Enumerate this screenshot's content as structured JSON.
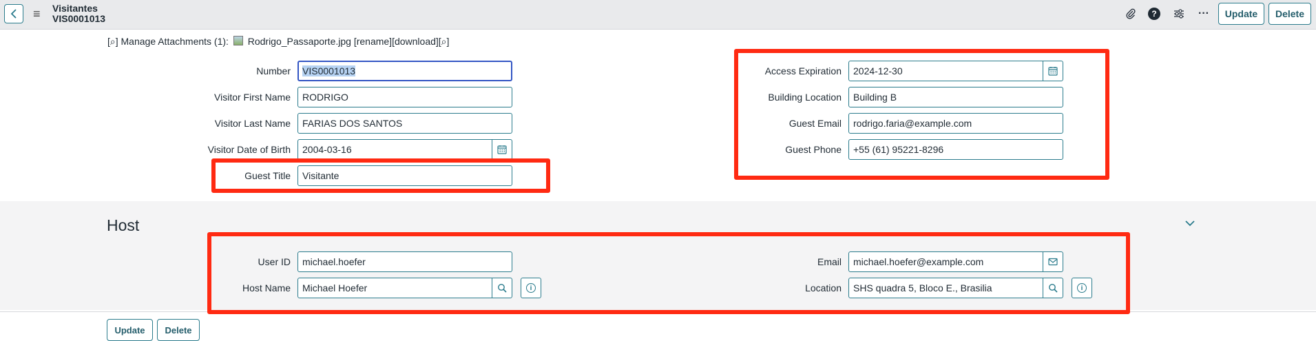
{
  "header": {
    "title": "Visitantes",
    "record_number": "VIS0001013",
    "update_label": "Update",
    "delete_label": "Delete",
    "help_glyph": "?",
    "more_glyph": "···"
  },
  "attachments": {
    "prefix": "[⌕] Manage Attachments (1):",
    "file_name": "Rodrigo_Passaporte.jpg",
    "actions": "[rename][download][⌕]"
  },
  "visitor": {
    "number_label": "Number",
    "number_value": "VIS0001013",
    "first_name_label": "Visitor First Name",
    "first_name_value": "RODRIGO",
    "last_name_label": "Visitor Last Name",
    "last_name_value": "FARIAS DOS SANTOS",
    "dob_label": "Visitor Date of Birth",
    "dob_value": "2004-03-16",
    "guest_title_label": "Guest Title",
    "guest_title_value": "Visitante",
    "access_expiration_label": "Access Expiration",
    "access_expiration_value": "2024-12-30",
    "building_location_label": "Building Location",
    "building_location_value": "Building B",
    "guest_email_label": "Guest Email",
    "guest_email_value": "rodrigo.faria@example.com",
    "guest_phone_label": "Guest Phone",
    "guest_phone_value": "+55 (61) 95221-8296"
  },
  "host": {
    "section_title": "Host",
    "user_id_label": "User ID",
    "user_id_value": "michael.hoefer",
    "host_name_label": "Host Name",
    "host_name_value": "Michael Hoefer",
    "email_label": "Email",
    "email_value": "michael.hoefer@example.com",
    "location_label": "Location",
    "location_value": "SHS quadra 5, Bloco E., Brasilia"
  },
  "footer": {
    "update_label": "Update",
    "delete_label": "Delete"
  },
  "colors": {
    "accent": "#2a7b8c",
    "highlight_box": "#ff2a12",
    "focus_border": "#3255c4"
  },
  "icons": [
    "back-icon",
    "menu-icon",
    "paperclip-icon",
    "help-icon",
    "sliders-icon",
    "more-icon",
    "calendar-icon",
    "search-icon",
    "info-icon",
    "mail-icon",
    "chevron-down-icon",
    "image-file-icon"
  ]
}
